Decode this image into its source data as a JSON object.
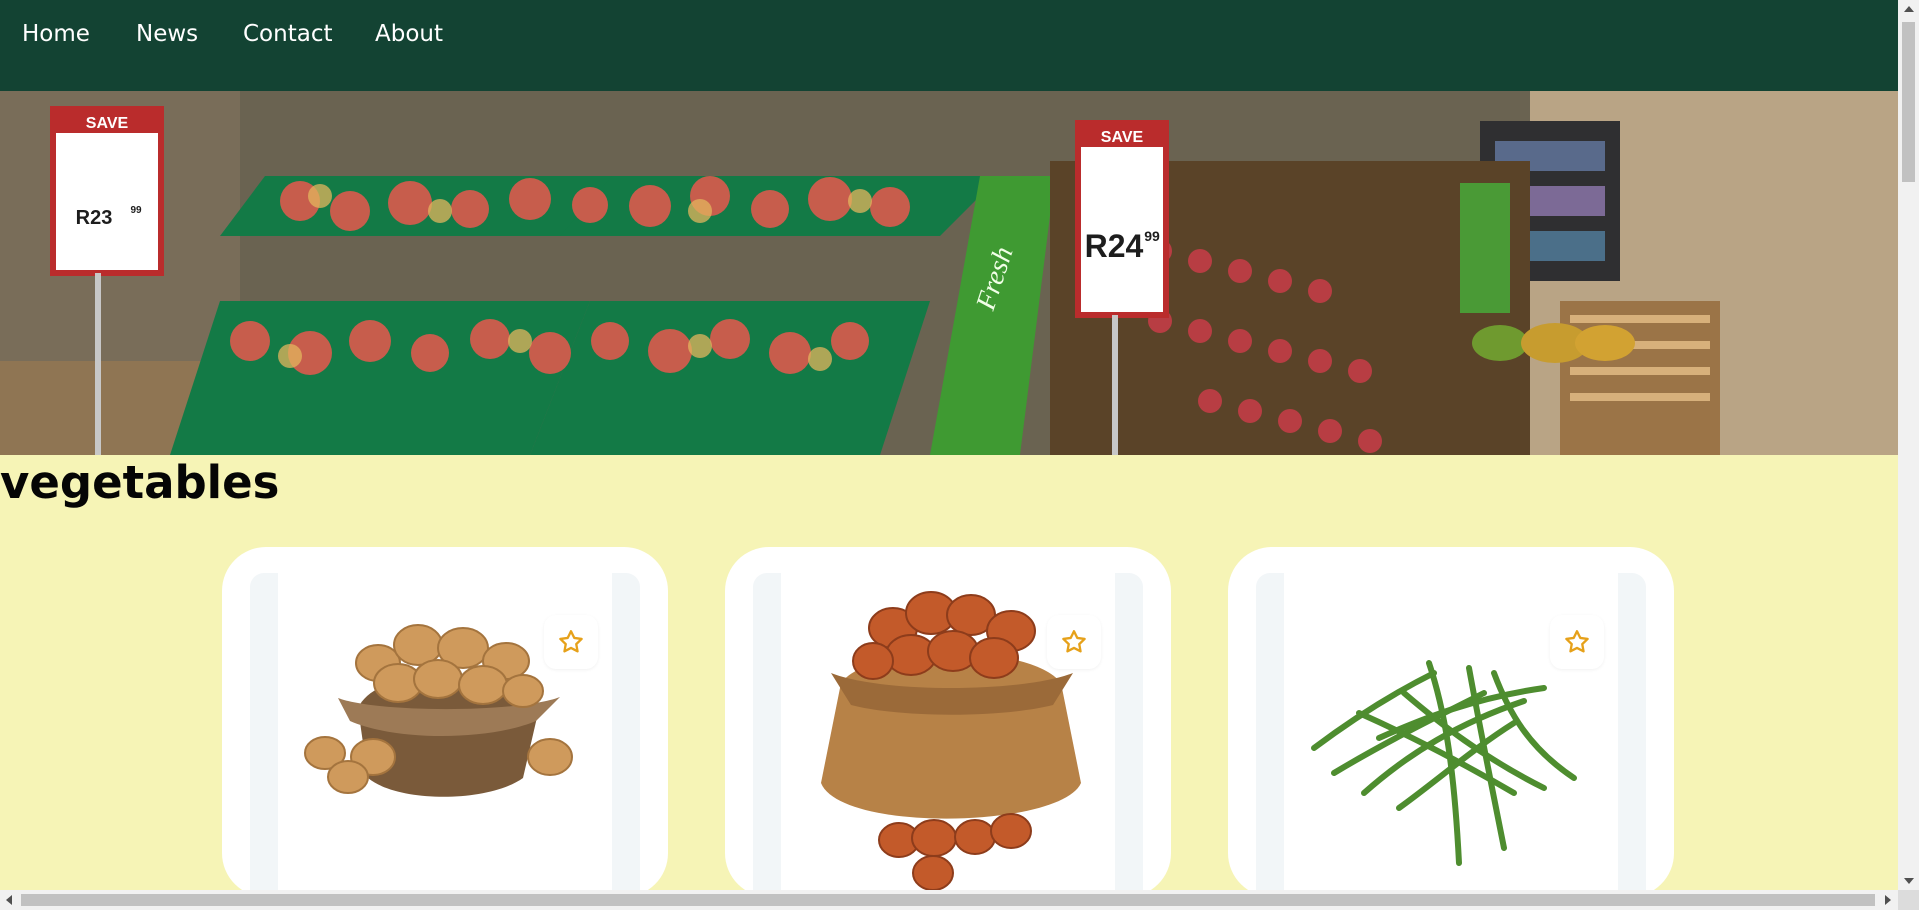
{
  "nav": {
    "items": [
      {
        "label": "Home"
      },
      {
        "label": "News"
      },
      {
        "label": "Contact"
      },
      {
        "label": "About"
      }
    ]
  },
  "hero": {
    "sign_left": {
      "title": "SAVE",
      "price": "R23",
      "cents": "99"
    },
    "sign_right": {
      "title": "SAVE",
      "price": "R24",
      "cents": "99"
    },
    "brand_text": "Fresh"
  },
  "section": {
    "title": "vegetables"
  },
  "products": [
    {
      "image": "potatoes",
      "icon": "star-icon"
    },
    {
      "image": "onions",
      "icon": "star-icon"
    },
    {
      "image": "green-beans",
      "icon": "star-icon"
    }
  ],
  "colors": {
    "navbar": "#134333",
    "background": "#f6f4b6",
    "star": "#e6a11a"
  }
}
